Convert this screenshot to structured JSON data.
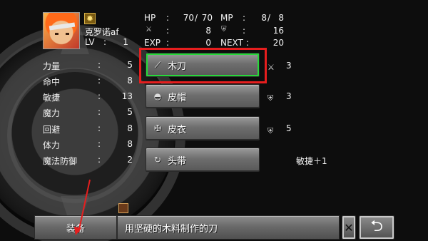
{
  "character": {
    "name": "克罗诺af",
    "level_label": "LV",
    "level": "1"
  },
  "header": {
    "hp_label": "HP",
    "hp_current": "70",
    "hp_max": "70",
    "mp_label": "MP",
    "mp_current": "8",
    "mp_max": "8",
    "attack": "8",
    "defense": "16",
    "exp_label": "EXP",
    "exp": "0",
    "next_label": "NEXT",
    "next": "20"
  },
  "stats": [
    {
      "label": "力量",
      "value": "5"
    },
    {
      "label": "命中",
      "value": "8"
    },
    {
      "label": "敏捷",
      "value": "13"
    },
    {
      "label": "魔力",
      "value": "5"
    },
    {
      "label": "回避",
      "value": "8"
    },
    {
      "label": "体力",
      "value": "8"
    },
    {
      "label": "魔法防御",
      "value": "2"
    }
  ],
  "equipment": [
    {
      "slot_icon": "sword-icon",
      "name": "木刀",
      "effect_icon": "sword-icon",
      "effect": "3"
    },
    {
      "slot_icon": "helmet-icon",
      "name": "皮帽",
      "effect_icon": "shield-icon",
      "effect": "3"
    },
    {
      "slot_icon": "armor-icon",
      "name": "皮衣",
      "effect_icon": "shield-icon",
      "effect": "5"
    },
    {
      "slot_icon": "accessory-icon",
      "name": "头带",
      "effect_icon": "",
      "effect": "敏捷＋1"
    }
  ],
  "bottom": {
    "equip_tab": "装备",
    "description": "用坚硬的木料制作的刀",
    "back_glyph": "⮌",
    "x_glyph": "✕"
  },
  "colors": {
    "selection": "#27d93a",
    "annotation": "#e61e1e"
  }
}
